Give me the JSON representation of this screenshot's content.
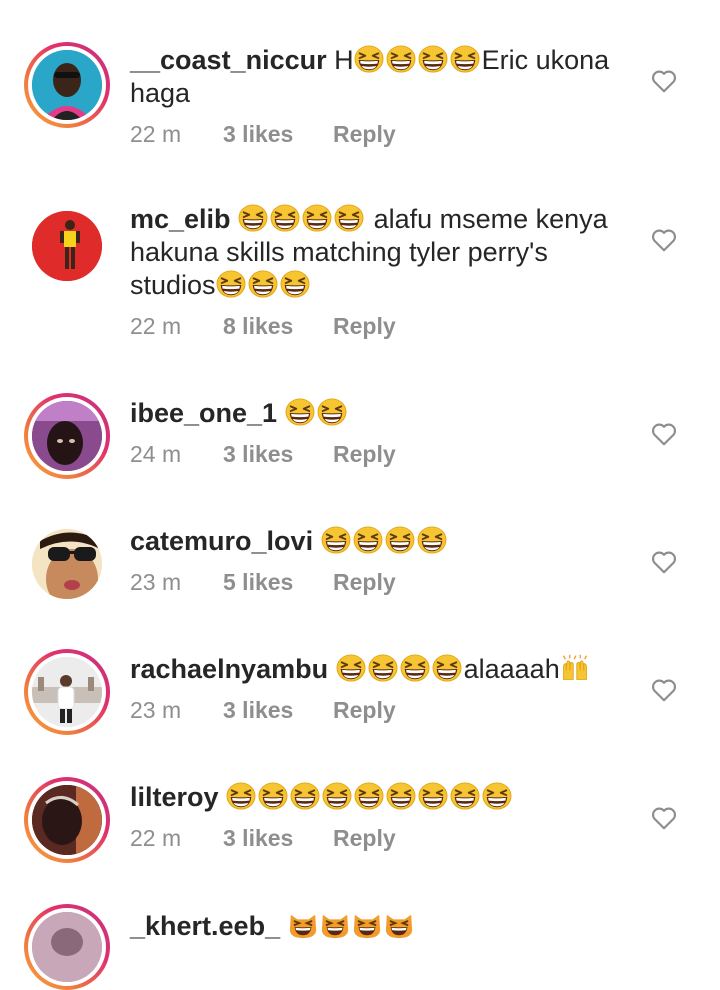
{
  "colors": {
    "username": "#262626",
    "meta_text": "#8e8e8e",
    "story_ring_start": "#f9a341",
    "story_ring_end": "#c13584"
  },
  "comments": [
    {
      "username": "__coast_niccur",
      "text_before": "H",
      "emoji_count": 4,
      "emoji": "grinning-squint-face",
      "text_after": "Eric ukona haga",
      "time": "22 m",
      "likes": "3 likes",
      "reply": "Reply",
      "avatar_ring": "story",
      "like_icon": "heart-outline-icon"
    },
    {
      "username": "mc_elib",
      "text_before": "",
      "emoji_count": 4,
      "emoji": "grinning-squint-face",
      "text_after": " alafu mseme kenya hakuna skills matching tyler perry's studios",
      "trailing_emoji_count": 3,
      "time": "22 m",
      "likes": "8 likes",
      "reply": "Reply",
      "avatar_ring": "none",
      "like_icon": "heart-outline-icon"
    },
    {
      "username": "ibee_one_1",
      "text_before": "",
      "emoji_count": 2,
      "emoji": "grinning-squint-face",
      "text_after": "",
      "time": "24 m",
      "likes": "3 likes",
      "reply": "Reply",
      "avatar_ring": "story",
      "like_icon": "heart-outline-icon"
    },
    {
      "username": "catemuro_lovi",
      "text_before": "",
      "emoji_count": 4,
      "emoji": "grinning-squint-face",
      "text_after": "",
      "time": "23 m",
      "likes": "5 likes",
      "reply": "Reply",
      "avatar_ring": "none",
      "like_icon": "heart-outline-icon"
    },
    {
      "username": "rachaelnyambu",
      "text_before": "",
      "emoji_count": 4,
      "emoji": "grinning-squint-face",
      "text_after": "alaaaah",
      "trailing_hands": true,
      "time": "23 m",
      "likes": "3 likes",
      "reply": "Reply",
      "avatar_ring": "story",
      "like_icon": "heart-outline-icon"
    },
    {
      "username": "lilteroy",
      "text_before": "",
      "emoji_count": 9,
      "emoji": "grinning-squint-face",
      "text_after": "",
      "time": "22 m",
      "likes": "3 likes",
      "reply": "Reply",
      "avatar_ring": "story",
      "like_icon": "heart-outline-icon"
    },
    {
      "username": "_khert.eeb_",
      "text_before": "",
      "emoji_count": 4,
      "emoji": "grinning-cat-face",
      "text_after": "",
      "avatar_ring": "story"
    }
  ]
}
